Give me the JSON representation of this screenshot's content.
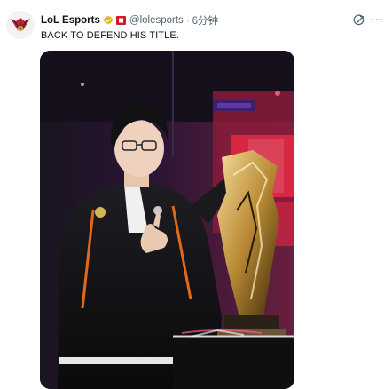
{
  "tweet": {
    "display_name": "LoL Esports",
    "handle": "@lolesports",
    "separator": "·",
    "time": "6分钟",
    "text": "BACK TO DEFEND HIS TITLE."
  },
  "icons": {
    "avatar": "lol-esports-logo",
    "verified": "verified-badge-gold",
    "affiliate": "affiliate-badge-red",
    "grok": "grok-icon",
    "more": "more-options-icon"
  },
  "more_glyph": "···",
  "colors": {
    "text_primary": "#0f1419",
    "text_secondary": "#536471",
    "verified_gold": "#e2b719",
    "affiliate_red": "#d7182a",
    "stage_red": "#c7223a",
    "stage_purple": "#3c1b62"
  }
}
